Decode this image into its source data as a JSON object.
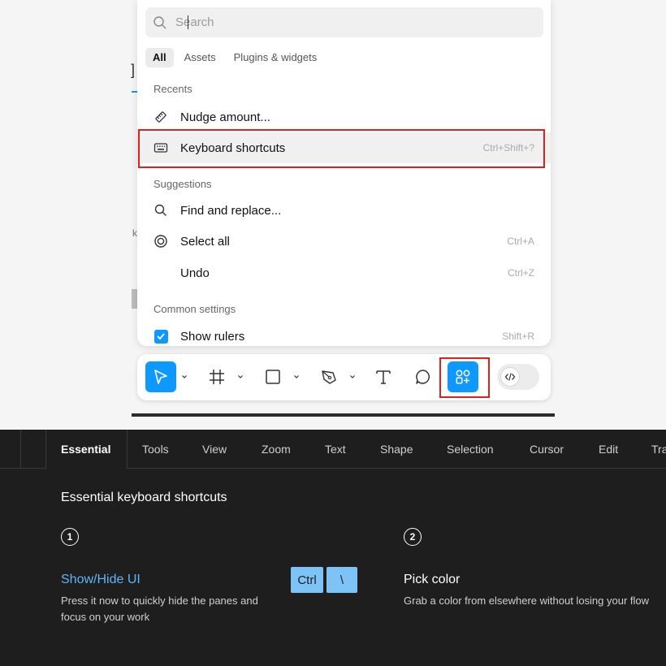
{
  "search": {
    "placeholder": "Search"
  },
  "filter_tabs": [
    "All",
    "Assets",
    "Plugins & widgets"
  ],
  "sections": {
    "recents": "Recents",
    "suggestions": "Suggestions",
    "common_settings": "Common settings"
  },
  "recents": [
    {
      "label": "Nudge amount...",
      "shortcut": "",
      "icon": "nudge-icon"
    },
    {
      "label": "Keyboard shortcuts",
      "shortcut": "Ctrl+Shift+?",
      "icon": "keyboard-icon"
    }
  ],
  "suggestions": [
    {
      "label": "Find and replace...",
      "shortcut": "",
      "icon": "search-icon"
    },
    {
      "label": "Select all",
      "shortcut": "Ctrl+A",
      "icon": "target-icon"
    },
    {
      "label": "Undo",
      "shortcut": "Ctrl+Z",
      "icon": ""
    }
  ],
  "settings": [
    {
      "label": "Show rulers",
      "shortcut": "Shift+R",
      "checked": true
    }
  ],
  "toolbar": {
    "tools": [
      "move-tool",
      "frame-tool",
      "rectangle-tool",
      "pen-tool",
      "text-tool",
      "comment-tool",
      "actions-tool",
      "dev-mode-toggle"
    ]
  },
  "shortcuts_panel": {
    "tabs": [
      "Essential",
      "Tools",
      "View",
      "Zoom",
      "Text",
      "Shape",
      "Selection",
      "Cursor",
      "Edit",
      "Tra"
    ],
    "active_tab": "Essential",
    "heading": "Essential keyboard shortcuts",
    "items": [
      {
        "number": "1",
        "title": "Show/Hide UI",
        "description": "Press it now to quickly hide the panes and focus on your work",
        "keys": [
          "Ctrl",
          "\\"
        ]
      },
      {
        "number": "2",
        "title": "Pick color",
        "description": "Grab a color from elsewhere without losing your flow",
        "keys": []
      }
    ]
  },
  "colors": {
    "accent": "#0d99ff",
    "highlight_border": "#e0201b",
    "dark_bg": "#1e1e1e",
    "link_title": "#5eb6f5",
    "key_bg": "#7dc3f5"
  }
}
